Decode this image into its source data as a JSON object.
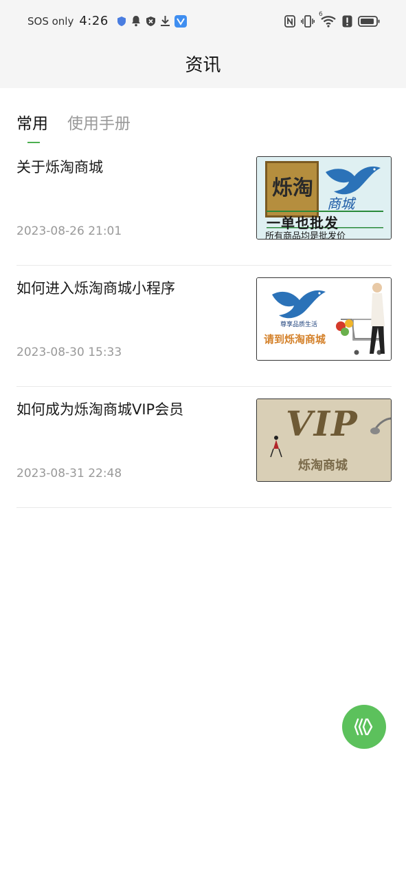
{
  "status_bar": {
    "carrier": "SOS only",
    "time": "4:26",
    "left_icons": [
      "shield-icon",
      "bell-icon",
      "blocked-icon",
      "download-icon",
      "app-notification-icon"
    ],
    "right_icons": [
      "nfc-icon",
      "vibrate-icon",
      "wifi-icon",
      "alert-icon",
      "battery-icon"
    ],
    "wifi_label": "6"
  },
  "header": {
    "title": "资讯"
  },
  "tabs": [
    {
      "label": "常用",
      "active": true
    },
    {
      "label": "使用手册",
      "active": false
    }
  ],
  "articles": [
    {
      "title": "关于烁淘商城",
      "date": "2023-08-26 21:01",
      "thumb": {
        "brand": "烁淘",
        "sub": "商城",
        "line1": "一单也批发",
        "line2": "所有商品均是批发价"
      }
    },
    {
      "title": "如何进入烁淘商城小程序",
      "date": "2023-08-30 15:33",
      "thumb": {
        "caption": "请到烁淘商城",
        "tagline": "尊享品质生活"
      }
    },
    {
      "title": "如何成为烁淘商城VIP会员",
      "date": "2023-08-31 22:48",
      "thumb": {
        "big": "VIP",
        "caption": "烁淘商城"
      }
    }
  ],
  "colors": {
    "accent": "#4caf50",
    "fab": "#5cc15c",
    "header_bg": "#f5f5f5"
  },
  "fab": {
    "icon": "wave-icon"
  }
}
